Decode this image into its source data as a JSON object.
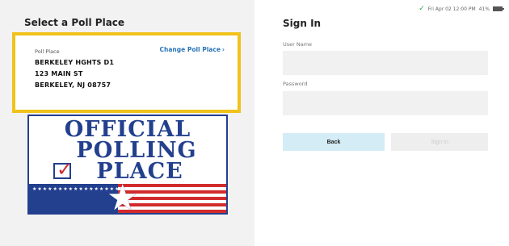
{
  "left": {
    "title": "Select a Poll Place",
    "card": {
      "label": "Poll Place",
      "change_link": "Change Poll Place",
      "change_chevron": "›",
      "name": "BERKELEY HGHTS D1",
      "street": "123 MAIN ST",
      "city": "BERKELEY, NJ 08757"
    },
    "sign": {
      "line1": "OFFICIAL",
      "line2": "POLLING",
      "line3": "PLACE",
      "check": "✓",
      "stars": "★★★★★★★★★★★★★★★★★★★★★★★★★★★★★★★★★★★★★★★★★★★★★★★★★★",
      "big_star": "★"
    }
  },
  "status_bar": {
    "check": "✓",
    "datetime": "Fri Apr 02  12:00 PM",
    "battery": "41%"
  },
  "signin": {
    "title": "Sign In",
    "username_label": "User Name",
    "password_label": "Password",
    "back_label": "Back",
    "signin_label": "Sign In"
  },
  "colors": {
    "card_border": "#f0c21b",
    "link": "#2a74b8",
    "back_button": "#d4ecf5",
    "sign_blue": "#23408e",
    "sign_red": "#d22b2b"
  }
}
